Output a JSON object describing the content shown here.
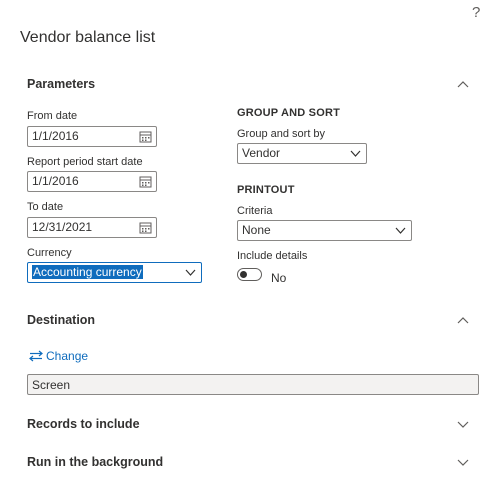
{
  "help": {
    "label": "?"
  },
  "page": {
    "title": "Vendor balance list"
  },
  "parameters": {
    "title": "Parameters",
    "from_date": {
      "label": "From date",
      "value": "1/1/2016"
    },
    "report_period_start": {
      "label": "Report period start date",
      "value": "1/1/2016"
    },
    "to_date": {
      "label": "To date",
      "value": "12/31/2021"
    },
    "currency": {
      "label": "Currency",
      "value": "Accounting currency"
    },
    "group_and_sort": {
      "heading": "GROUP AND SORT",
      "label": "Group and sort by",
      "value": "Vendor"
    },
    "printout": {
      "heading": "PRINTOUT",
      "criteria_label": "Criteria",
      "criteria_value": "None",
      "include_details_label": "Include details",
      "include_details_value": "No",
      "include_details_on": false
    }
  },
  "destination": {
    "title": "Destination",
    "change_label": "Change",
    "value": "Screen"
  },
  "records": {
    "title": "Records to include"
  },
  "background": {
    "title": "Run in the background"
  },
  "colors": {
    "accent": "#0f6cbd",
    "text": "#323130",
    "border": "#8a8886"
  }
}
